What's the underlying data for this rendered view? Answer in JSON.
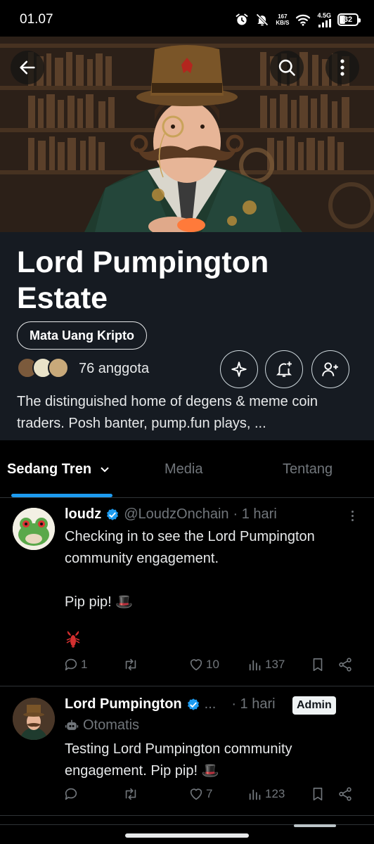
{
  "status_bar": {
    "time": "01.07",
    "net_speed_value": "167",
    "net_speed_unit": "KB/S",
    "network_type": "4.5G",
    "battery": "32"
  },
  "community": {
    "name": "Lord Pumpington Estate",
    "topic": "Mata Uang Kripto",
    "members": "76 anggota",
    "description": "The distinguished home of degens & meme coin traders. Posh banter, pump.fun plays, ..."
  },
  "tabs": [
    {
      "label": "Sedang Tren",
      "active": true
    },
    {
      "label": "Media",
      "active": false
    },
    {
      "label": "Tentang",
      "active": false
    }
  ],
  "posts": [
    {
      "name": "loudz",
      "handle": "@LoudzOnchain",
      "time": "· 1 hari",
      "text": "Checking in to see the Lord Pumpington community engagement.\n\nPip pip! 🎩",
      "stats": {
        "replies": "1",
        "reposts": "",
        "likes": "10",
        "views": "137"
      }
    },
    {
      "name": "Lord Pumpington",
      "handle": "...",
      "time": "· 1 hari",
      "badge": "Admin",
      "automated_label": "Otomatis",
      "text": "Testing Lord Pumpington community engagement. Pip pip! 🎩",
      "stats": {
        "replies": "",
        "reposts": "",
        "likes": "7",
        "views": "123"
      }
    }
  ],
  "colors": {
    "accent": "#1d9bf0",
    "background": "#000000",
    "info_panel": "#161b22",
    "muted_text": "#71767b"
  },
  "icons": [
    "back-arrow-icon",
    "search-icon",
    "more-vertical-icon",
    "sparkle-icon",
    "bell-plus-icon",
    "person-plus-icon",
    "verified-icon",
    "reply-icon",
    "repost-icon",
    "like-icon",
    "views-icon",
    "bookmark-icon",
    "share-icon",
    "robot-icon"
  ]
}
